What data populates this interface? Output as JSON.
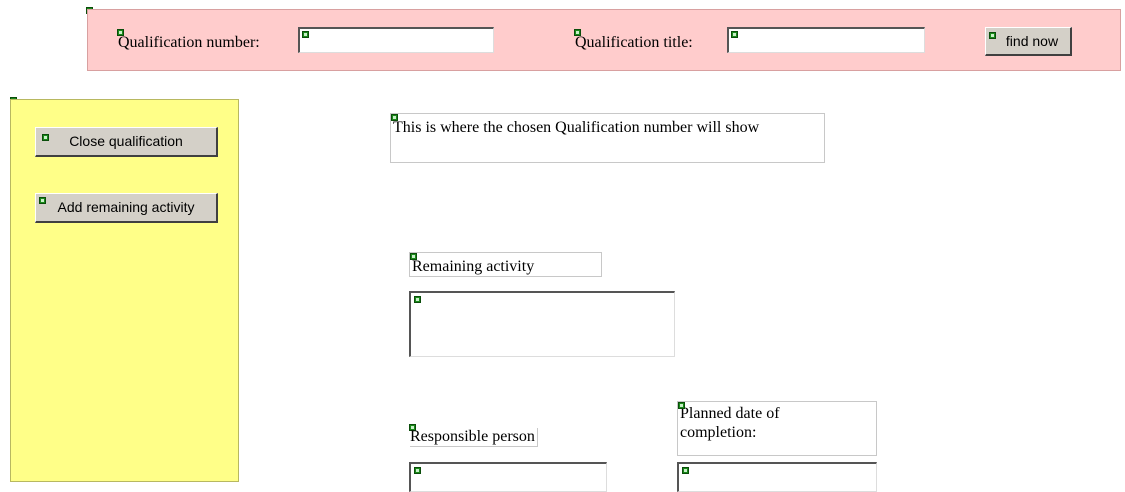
{
  "search": {
    "qual_number_label": "Qualification number:",
    "qual_number_value": "",
    "qual_title_label": "Qualification title:",
    "qual_title_value": "",
    "find_button": "find now"
  },
  "sidebar": {
    "close_button": "Close qualification",
    "add_button": "Add remaining activity"
  },
  "main": {
    "chosen_qualification_text": "This is where the chosen Qualification number will show",
    "remaining_activity_label": "Remaining activity",
    "remaining_activity_value": "",
    "responsible_person_label": "Responsible person",
    "responsible_person_value": "",
    "planned_date_label": "Planned date of completion:",
    "planned_date_value": ""
  },
  "colors": {
    "search_bar_bg": "#ffcccc",
    "side_panel_bg": "#ffff88",
    "marker": "#1a8a1a"
  }
}
